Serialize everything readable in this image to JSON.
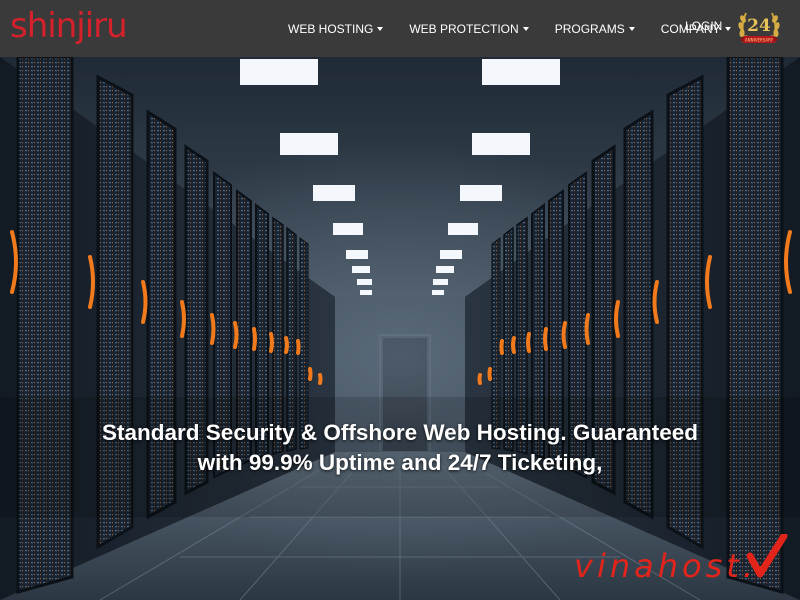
{
  "header": {
    "logo_text": "shinjiru",
    "logo_color": "#d4212b",
    "nav": [
      {
        "label": "WEB HOSTING",
        "has_dropdown": true
      },
      {
        "label": "WEB PROTECTION",
        "has_dropdown": true
      },
      {
        "label": "PROGRAMS",
        "has_dropdown": true
      },
      {
        "label": "COMPANY",
        "has_dropdown": true
      }
    ],
    "login_label": "LOGIN",
    "anniversary_badge": {
      "number": "24",
      "ribbon_text": "ANNIVERSARY"
    }
  },
  "hero": {
    "headline_line1": "Standard Security & Offshore Web Hosting. Guaranteed",
    "headline_line2": "with 99.9% Uptime and 24/7 Ticketing,"
  },
  "watermark": {
    "text": "vinahost.",
    "color": "#e2241b"
  }
}
